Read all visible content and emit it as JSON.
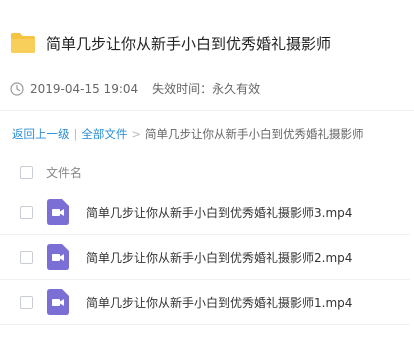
{
  "header": {
    "title": "简单几步让你从新手小白到优秀婚礼摄影师",
    "folder_icon": "folder-icon",
    "folder_color": "#f6c443"
  },
  "meta": {
    "date": "2019-04-15 19:04",
    "expiry": "失效时间：永久有效",
    "clock_icon": "clock-icon"
  },
  "breadcrumb": {
    "back": "返回上一级",
    "sep": "|",
    "all": "全部文件",
    "arrow": ">",
    "current": "简单几步让你从新手小白到优秀婚礼摄影师",
    "link_color": "#2b8ed8"
  },
  "list": {
    "column_label": "文件名",
    "files": [
      {
        "name": "简单几步让你从新手小白到优秀婚礼摄影师3.mp4",
        "icon": "video-file-icon"
      },
      {
        "name": "简单几步让你从新手小白到优秀婚礼摄影师2.mp4",
        "icon": "video-file-icon"
      },
      {
        "name": "简单几步让你从新手小白到优秀婚礼摄影师1.mp4",
        "icon": "video-file-icon"
      }
    ],
    "video_icon_color": "#7b6fd6"
  }
}
